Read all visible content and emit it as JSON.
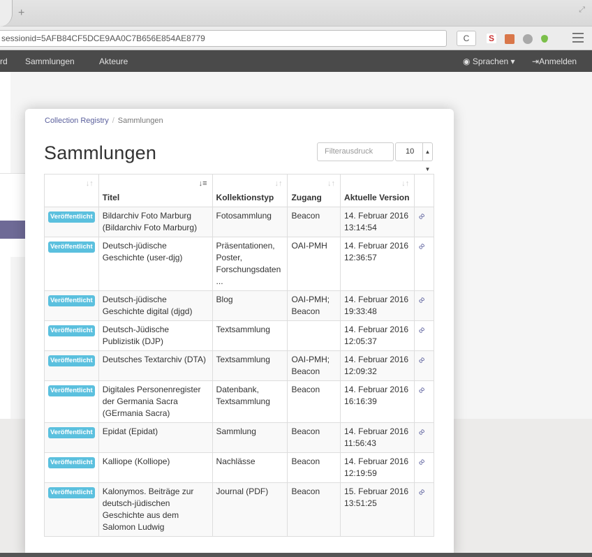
{
  "browser": {
    "new_tab_label": "+",
    "url_text": "sessionid=5AFB84CF5DCE9AA0C7B656E854AE8779",
    "reload_label": "C",
    "ext_s_label": "S",
    "navbar": {
      "items": [
        "rd",
        "Sammlungen",
        "Akteure"
      ],
      "language_label": "Sprachen",
      "login_label": "Anmelden"
    }
  },
  "breadcrumb": {
    "root": "Collection Registry",
    "separator": "/",
    "current": "Sammlungen"
  },
  "page_title": "Sammlungen",
  "filter": {
    "placeholder": "Filterausdruck",
    "page_size": "10"
  },
  "table": {
    "headers": [
      "",
      "Titel",
      "Kollektionstyp",
      "Zugang",
      "Aktuelle Version",
      ""
    ],
    "rows": [
      {
        "status": "Veröffentlicht",
        "title": "Bildarchiv Foto Marburg (Bildarchiv Foto Marburg)",
        "type": "Fotosammlung",
        "access": "Beacon",
        "version": "14. Februar 2016 13:14:54"
      },
      {
        "status": "Veröffentlicht",
        "title": "Deutsch-jüdische Geschichte (user-djg)",
        "type": "Präsentationen, Poster, Forschungsdaten ...",
        "access": "OAI-PMH",
        "version": "14. Februar 2016 12:36:57"
      },
      {
        "status": "Veröffentlicht",
        "title": "Deutsch-jüdische Geschichte digital (djgd)",
        "type": "Blog",
        "access": "OAI-PMH; Beacon",
        "version": "14. Februar 2016 19:33:48"
      },
      {
        "status": "Veröffentlicht",
        "title": "Deutsch-Jüdische Publizistik (DJP)",
        "type": "Textsammlung",
        "access": "",
        "version": "14. Februar 2016 12:05:37"
      },
      {
        "status": "Veröffentlicht",
        "title": "Deutsches Textarchiv (DTA)",
        "type": "Textsammlung",
        "access": "OAI-PMH; Beacon",
        "version": "14. Februar 2016 12:09:32"
      },
      {
        "status": "Veröffentlicht",
        "title": "Digitales Personenregister der Germania Sacra (GErmania Sacra)",
        "type": "Datenbank, Textsammlung",
        "access": "Beacon",
        "version": "14. Februar 2016 16:16:39"
      },
      {
        "status": "Veröffentlicht",
        "title": "Epidat (Epidat)",
        "type": "Sammlung",
        "access": "Beacon",
        "version": "14. Februar 2016 11:56:43"
      },
      {
        "status": "Veröffentlicht",
        "title": "Kalliope (Kolliope)",
        "type": "Nachlässe",
        "access": "Beacon",
        "version": "14. Februar 2016 12:19:59"
      },
      {
        "status": "Veröffentlicht",
        "title": "Kalonymos. Beiträge zur deutsch-jüdischen Geschichte aus dem Salomon Ludwig",
        "type": "Journal (PDF)",
        "access": "Beacon",
        "version": "15. Februar 2016 13:51:25"
      }
    ]
  },
  "colors": {
    "badge": "#5bc0de",
    "link": "#5a5f9c",
    "navbar": "#4a4a4a"
  },
  "icons": {
    "sort": "sort-icon",
    "link": "link-icon",
    "globe": "globe-icon",
    "login": "login-icon"
  }
}
